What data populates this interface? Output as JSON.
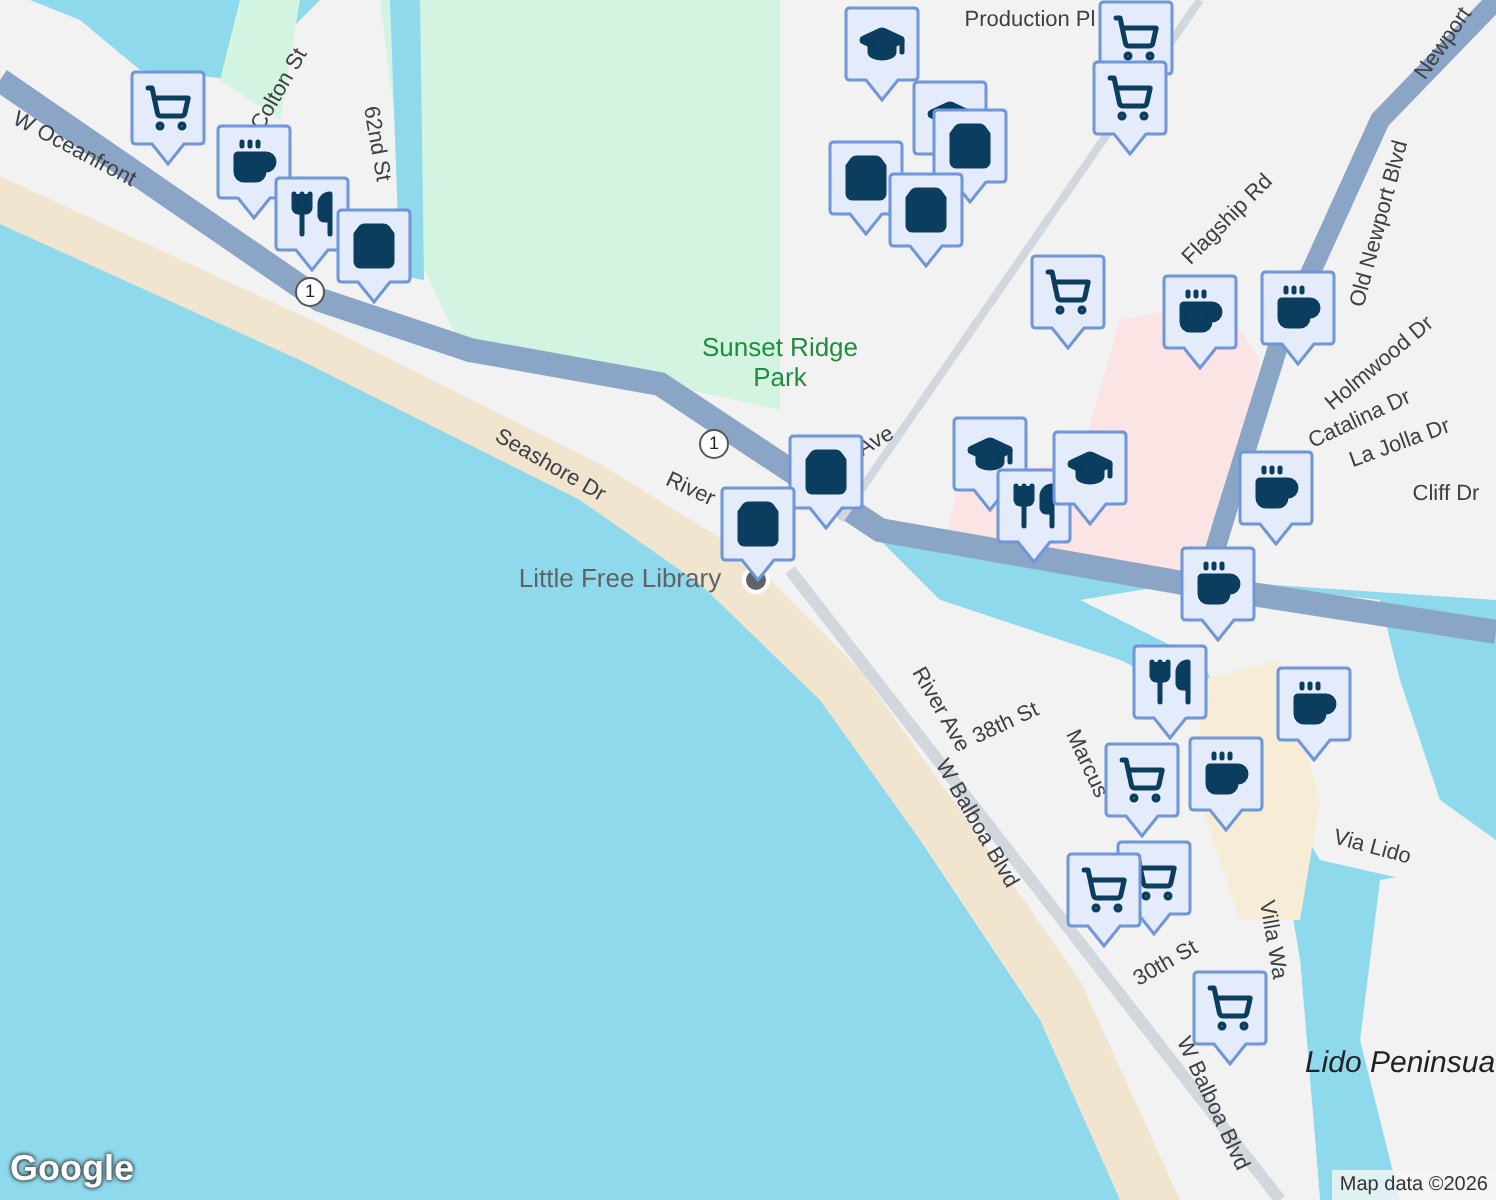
{
  "map": {
    "labels": [
      {
        "text": "Colton St",
        "kind": "street"
      },
      {
        "text": "62nd St",
        "kind": "street"
      },
      {
        "text": "W Oceanfront",
        "kind": "street"
      },
      {
        "text": "Seashore Dr",
        "kind": "street"
      },
      {
        "text": "River",
        "kind": "street"
      },
      {
        "text": "Ave",
        "kind": "street"
      },
      {
        "text": "Sunset Ridge Park",
        "kind": "park"
      },
      {
        "text": "Little Free Library",
        "kind": "place"
      },
      {
        "text": "Production Pl",
        "kind": "street"
      },
      {
        "text": "Newport",
        "kind": "street"
      },
      {
        "text": "Flagship Rd",
        "kind": "street"
      },
      {
        "text": "Old Newport Blvd",
        "kind": "street"
      },
      {
        "text": "Holmwood Dr",
        "kind": "street"
      },
      {
        "text": "Catalina Dr",
        "kind": "street"
      },
      {
        "text": "La Jolla Dr",
        "kind": "street"
      },
      {
        "text": "Cliff Dr",
        "kind": "street"
      },
      {
        "text": "River Ave",
        "kind": "street"
      },
      {
        "text": "38th St",
        "kind": "street"
      },
      {
        "text": "Marcus",
        "kind": "street"
      },
      {
        "text": "W Balboa Blvd",
        "kind": "street"
      },
      {
        "text": "Via Lido",
        "kind": "street"
      },
      {
        "text": "30th St",
        "kind": "street"
      },
      {
        "text": "Villa Wa",
        "kind": "street"
      },
      {
        "text": "W Balboa Blvd",
        "kind": "street"
      },
      {
        "text": "Lido Peninsua",
        "kind": "area"
      },
      {
        "text": "1",
        "kind": "shield"
      },
      {
        "text": "1",
        "kind": "shield"
      }
    ],
    "markers": [
      {
        "kind": "cart"
      },
      {
        "kind": "cup"
      },
      {
        "kind": "fork"
      },
      {
        "kind": "bag"
      },
      {
        "kind": "cap"
      },
      {
        "kind": "cart"
      },
      {
        "kind": "cart"
      },
      {
        "kind": "cap"
      },
      {
        "kind": "bag"
      },
      {
        "kind": "bag"
      },
      {
        "kind": "bag"
      },
      {
        "kind": "cart"
      },
      {
        "kind": "cup"
      },
      {
        "kind": "cup"
      },
      {
        "kind": "bag"
      },
      {
        "kind": "bag"
      },
      {
        "kind": "cap"
      },
      {
        "kind": "fork"
      },
      {
        "kind": "cap"
      },
      {
        "kind": "cup"
      },
      {
        "kind": "cup"
      },
      {
        "kind": "fork"
      },
      {
        "kind": "cart"
      },
      {
        "kind": "cup"
      },
      {
        "kind": "cup"
      },
      {
        "kind": "cart"
      },
      {
        "kind": "cart"
      },
      {
        "kind": "cart"
      }
    ]
  },
  "logo": "Google",
  "attribution": "Map data ©2026"
}
